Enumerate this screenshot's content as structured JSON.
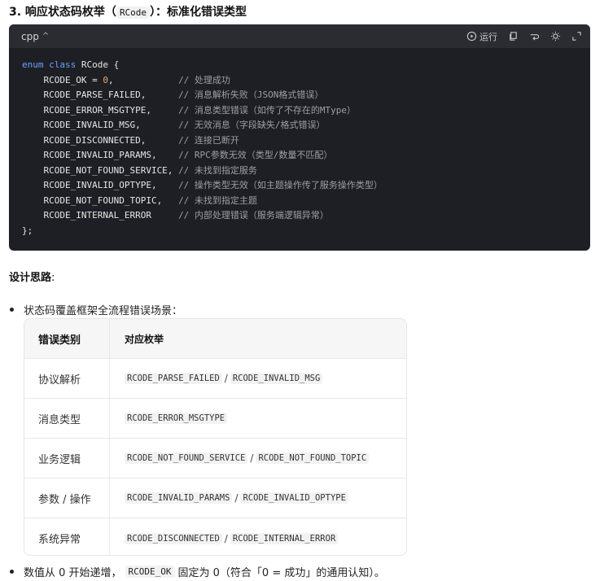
{
  "heading": {
    "prefix": "3. 响应状态码枚举（",
    "code": "RCode",
    "suffix": "）：标准化错误类型"
  },
  "codeblock": {
    "language": "cpp",
    "chevron": "^",
    "run_label": "运行",
    "icons": [
      "play-icon",
      "copy-icon",
      "wrap-icon",
      "theme-icon",
      "expand-icon"
    ],
    "lines": [
      {
        "kind": "open",
        "kw1": "enum",
        "kw2": "class",
        "name": "RCode",
        "brace": " {"
      },
      {
        "ident": "    RCODE_OK = ",
        "num": "0",
        "after": ",            ",
        "comment": "// 处理成功"
      },
      {
        "ident": "    RCODE_PARSE_FAILED,      ",
        "comment": "// 消息解析失败（JSON格式错误）"
      },
      {
        "ident": "    RCODE_ERROR_MSGTYPE,     ",
        "comment": "// 消息类型错误（如传了不存在的MType）"
      },
      {
        "ident": "    RCODE_INVALID_MSG,       ",
        "comment": "// 无效消息（字段缺失/格式错误）"
      },
      {
        "ident": "    RCODE_DISCONNECTED,      ",
        "comment": "// 连接已断开"
      },
      {
        "ident": "    RCODE_INVALID_PARAMS,    ",
        "comment": "// RPC参数无效（类型/数量不匹配）"
      },
      {
        "ident": "    RCODE_NOT_FOUND_SERVICE, ",
        "comment": "// 未找到指定服务"
      },
      {
        "ident": "    RCODE_INVALID_OPTYPE,    ",
        "comment": "// 操作类型无效（如主题操作传了服务操作类型）"
      },
      {
        "ident": "    RCODE_NOT_FOUND_TOPIC,   ",
        "comment": "// 未找到指定主题"
      },
      {
        "ident": "    RCODE_INTERNAL_ERROR     ",
        "comment": "// 内部处理错误（服务端逻辑异常）"
      },
      {
        "kind": "close",
        "text": "};"
      }
    ]
  },
  "design": {
    "title": "设计思路",
    "colon": ":"
  },
  "bullet1": "状态码覆盖框架全流程错误场景：",
  "table": {
    "headers": [
      "错误类别",
      "对应枚举"
    ],
    "rows": [
      {
        "category": "协议解析",
        "a": "RCODE_PARSE_FAILED",
        "b": "RCODE_INVALID_MSG"
      },
      {
        "category": "消息类型",
        "a": "RCODE_ERROR_MSGTYPE",
        "b": ""
      },
      {
        "category": "业务逻辑",
        "a": "RCODE_NOT_FOUND_SERVICE",
        "b": "RCODE_NOT_FOUND_TOPIC"
      },
      {
        "category": "参数 / 操作",
        "a": "RCODE_INVALID_PARAMS",
        "b": "RCODE_INVALID_OPTYPE"
      },
      {
        "category": "系统异常",
        "a": "RCODE_DISCONNECTED",
        "b": "RCODE_INTERNAL_ERROR"
      }
    ],
    "separator": "/"
  },
  "bullet2": {
    "before": "数值从 0 开始递增，",
    "code": "RCODE_OK",
    "after": "固定为 0（符合「0 = 成功」的通用认知）。"
  }
}
